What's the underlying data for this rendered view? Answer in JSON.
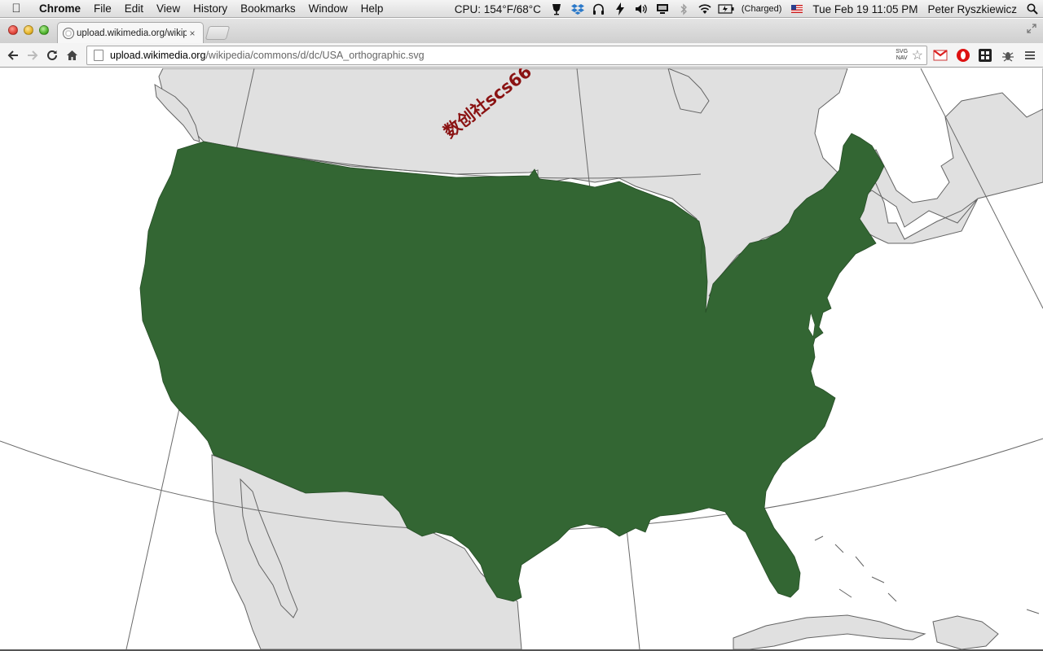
{
  "menubar": {
    "app_name": "Chrome",
    "menus": [
      "File",
      "Edit",
      "View",
      "History",
      "Bookmarks",
      "Window",
      "Help"
    ],
    "cpu": "CPU: 154°F/68°C",
    "battery": "(Charged)",
    "clock": "Tue Feb 19  11:05 PM",
    "user": "Peter Ryszkiewicz"
  },
  "tab": {
    "title": "upload.wikimedia.org/wikipe",
    "close": "×"
  },
  "omnibox": {
    "url_host": "upload.wikimedia.org",
    "url_path": "/wikipedia/commons/d/dc/USA_orthographic.svg",
    "svgnav_line1": "SVG",
    "svgnav_line2": "NAV"
  },
  "watermark": "数创社scs66",
  "icons": {
    "apple": "apple-icon",
    "search": "spotlight-icon"
  },
  "colors": {
    "usa_fill": "#336633",
    "land_fill": "#e0e0e0",
    "ocean": "#ffffff",
    "border": "#646464"
  }
}
